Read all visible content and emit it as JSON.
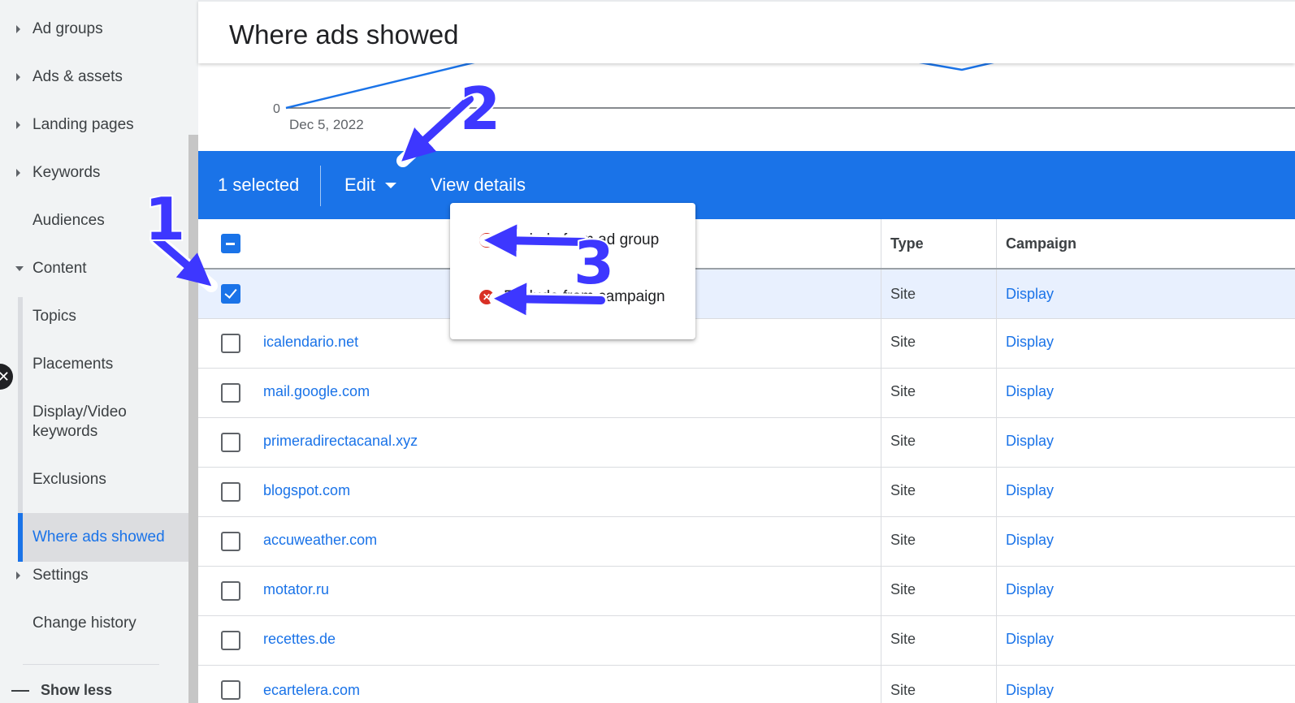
{
  "sidebar": {
    "items": [
      {
        "label": "Ad groups"
      },
      {
        "label": "Ads & assets"
      },
      {
        "label": "Landing pages"
      },
      {
        "label": "Keywords"
      },
      {
        "label": "Audiences"
      },
      {
        "label": "Content"
      },
      {
        "label": "Topics"
      },
      {
        "label": "Placements"
      },
      {
        "label": "Display/Video keywords"
      },
      {
        "label": "Exclusions"
      },
      {
        "label": "Where ads showed"
      },
      {
        "label": "Settings"
      },
      {
        "label": "Change history"
      }
    ],
    "show_less": "Show less",
    "close_glyph": "✕"
  },
  "header": {
    "title": "Where ads showed"
  },
  "chart": {
    "zero_label": "0",
    "date_label": "Dec 5, 2022",
    "line_color": "#1a73e8"
  },
  "action_bar": {
    "selected": "1 selected",
    "edit": "Edit",
    "view_details": "View details",
    "color": "#1a73e8"
  },
  "dropdown": {
    "items": [
      {
        "label": "Exclude from ad group"
      },
      {
        "label": "Exclude from campaign"
      }
    ],
    "icon_glyph": "✕"
  },
  "table": {
    "columns": {
      "type": "Type",
      "campaign": "Campaign"
    },
    "rows": [
      {
        "placement": "",
        "type": "Site",
        "campaign": "Display",
        "checked": true
      },
      {
        "placement": "icalendario.net",
        "type": "Site",
        "campaign": "Display"
      },
      {
        "placement": "mail.google.com",
        "type": "Site",
        "campaign": "Display"
      },
      {
        "placement": "primeradirectacanal.xyz",
        "type": "Site",
        "campaign": "Display"
      },
      {
        "placement": "blogspot.com",
        "type": "Site",
        "campaign": "Display"
      },
      {
        "placement": "accuweather.com",
        "type": "Site",
        "campaign": "Display"
      },
      {
        "placement": "motator.ru",
        "type": "Site",
        "campaign": "Display"
      },
      {
        "placement": "recettes.de",
        "type": "Site",
        "campaign": "Display"
      },
      {
        "placement": "ecartelera.com",
        "type": "Site",
        "campaign": "Display"
      }
    ]
  },
  "annotations": {
    "n1": "1",
    "n2": "2",
    "n3": "3",
    "arrow_color": "#3d37ff"
  }
}
